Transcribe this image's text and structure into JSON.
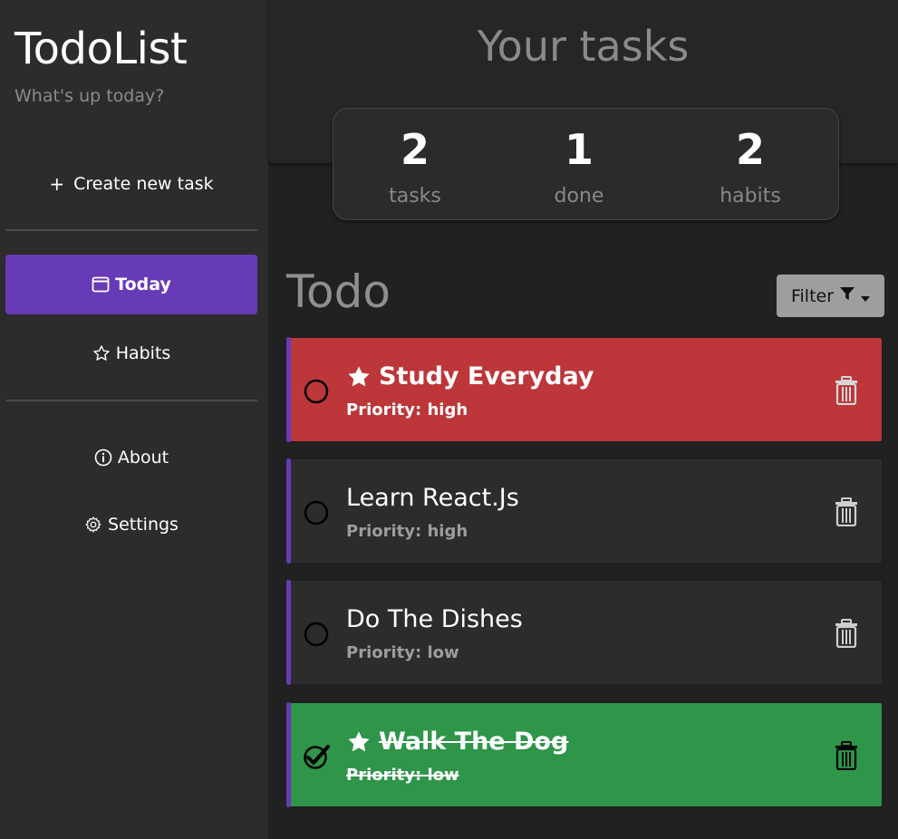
{
  "sidebar": {
    "title": "TodoList",
    "subtitle": "What's up today?",
    "create_label": "Create new task",
    "nav": {
      "today": "Today",
      "habits": "Habits",
      "about": "About",
      "settings": "Settings"
    }
  },
  "main": {
    "title": "Your tasks",
    "stats": [
      {
        "value": "2",
        "label": "tasks"
      },
      {
        "value": "1",
        "label": "done"
      },
      {
        "value": "2",
        "label": "habits"
      }
    ],
    "section_title": "Todo",
    "filter_label": "Filter"
  },
  "tasks": [
    {
      "name": "Study Everyday",
      "priority": "Priority: high",
      "starred": true,
      "done": false,
      "color": "#bc363a"
    },
    {
      "name": "Learn React.Js",
      "priority": "Priority: high",
      "starred": false,
      "done": false,
      "color": "#2c2c2c"
    },
    {
      "name": "Do The Dishes",
      "priority": "Priority: low",
      "starred": false,
      "done": false,
      "color": "#2c2c2c"
    },
    {
      "name": "Walk The Dog",
      "priority": "Priority: low",
      "starred": true,
      "done": true,
      "color": "#2e9549"
    }
  ],
  "colors": {
    "accent": "#673ab7",
    "high_priority_starred": "#bc363a",
    "completed": "#2e9549"
  }
}
